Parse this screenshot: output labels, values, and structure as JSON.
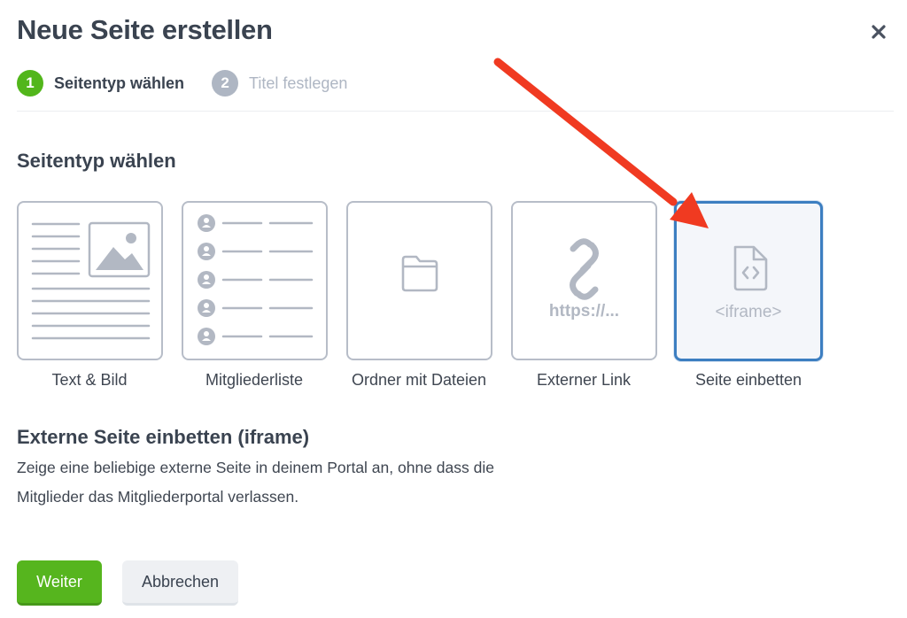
{
  "dialog": {
    "title": "Neue Seite erstellen",
    "close_icon": "close-icon"
  },
  "steps": [
    {
      "number": "1",
      "label": "Seitentyp wählen",
      "state": "active"
    },
    {
      "number": "2",
      "label": "Titel festlegen",
      "state": "inactive"
    }
  ],
  "section": {
    "title": "Seitentyp wählen"
  },
  "page_types": [
    {
      "label": "Text & Bild",
      "icon": "text-image-icon",
      "selected": false
    },
    {
      "label": "Mitgliederliste",
      "icon": "member-list-icon",
      "selected": false
    },
    {
      "label": "Ordner mit Dateien",
      "icon": "folder-icon",
      "selected": false
    },
    {
      "label": "Externer Link",
      "icon": "link-icon",
      "preview_text": "https://...",
      "selected": false
    },
    {
      "label": "Seite einbetten",
      "icon": "code-file-icon",
      "preview_text": "<iframe>",
      "selected": true
    }
  ],
  "description": {
    "title": "Externe Seite einbetten (iframe)",
    "line1": "Zeige eine beliebige externe Seite in deinem Portal an, ohne dass die",
    "line2": "Mitglieder das Mitgliederportal verlassen."
  },
  "actions": {
    "primary_label": "Weiter",
    "secondary_label": "Abbrechen"
  },
  "colors": {
    "accent_green": "#52b61b",
    "selected_border": "#3c7ec1",
    "annotation_arrow": "#f03a21"
  }
}
